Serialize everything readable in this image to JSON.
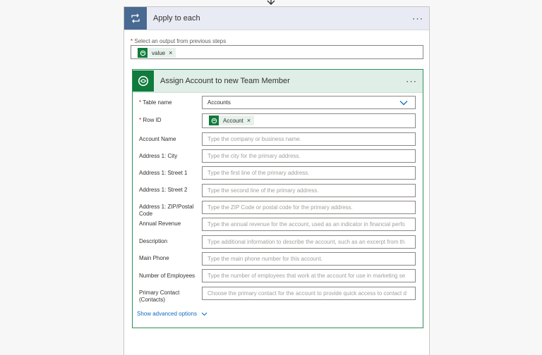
{
  "outer": {
    "title": "Apply to each",
    "more_label": "···",
    "select_label_required": "*",
    "select_label": "Select an output from previous steps",
    "token": {
      "label": "value",
      "remove": "×"
    }
  },
  "inner": {
    "title": "Assign Account to new Team Member",
    "more_label": "···",
    "table_name": {
      "required": "*",
      "label": "Table name",
      "value": "Accounts"
    },
    "row_id": {
      "required": "*",
      "label": "Row ID",
      "token_label": "Account",
      "token_remove": "×"
    },
    "fields": [
      {
        "label": "Account Name",
        "placeholder": "Type the company or business name."
      },
      {
        "label": "Address 1: City",
        "placeholder": "Type the city for the primary address."
      },
      {
        "label": "Address 1: Street 1",
        "placeholder": "Type the first line of the primary address."
      },
      {
        "label": "Address 1: Street 2",
        "placeholder": "Type the second line of the primary address."
      },
      {
        "label": "Address 1: ZIP/Postal Code",
        "placeholder": "Type the ZIP Code or postal code for the primary address."
      },
      {
        "label": "Annual Revenue",
        "placeholder": "Type the annual revenue for the account, used as an indicator in financial perfo"
      },
      {
        "label": "Description",
        "placeholder": "Type additional information to describe the account, such as an excerpt from th"
      },
      {
        "label": "Main Phone",
        "placeholder": "Type the main phone number for this account."
      },
      {
        "label": "Number of Employees",
        "placeholder": "Type the number of employees that work at the account for use in marketing se"
      },
      {
        "label": "Primary Contact (Contacts)",
        "placeholder": "Choose the primary contact for the account to provide quick access to contact d"
      }
    ],
    "advanced_label": "Show advanced options"
  }
}
